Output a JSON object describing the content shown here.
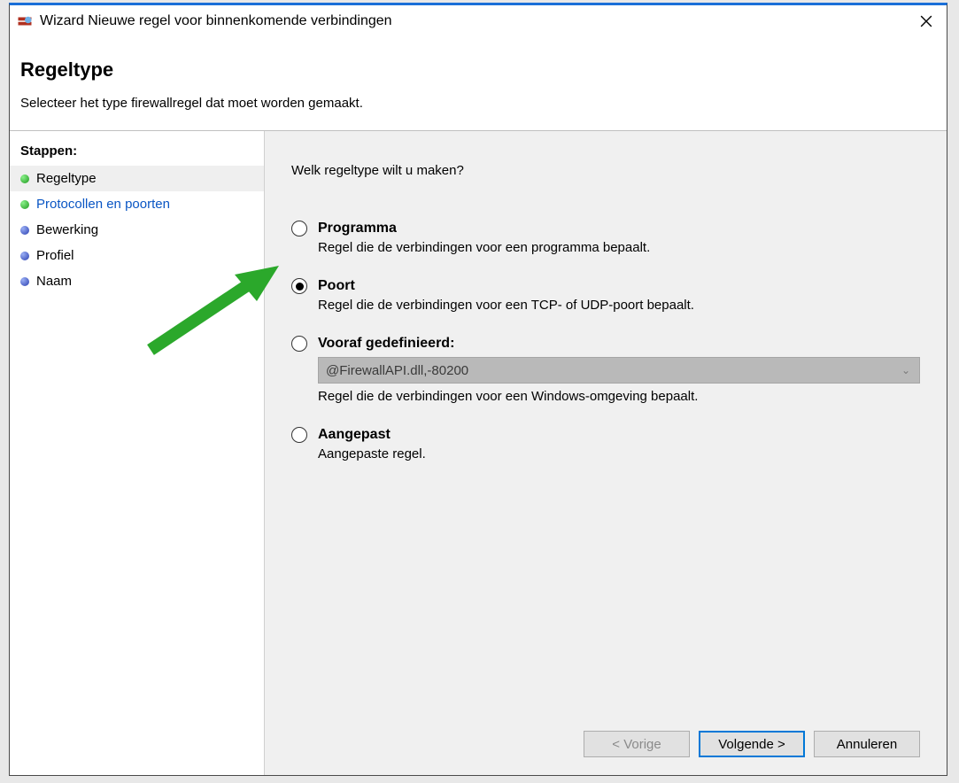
{
  "window": {
    "title": "Wizard Nieuwe regel voor binnenkomende verbindingen"
  },
  "header": {
    "page_title": "Regeltype",
    "page_subtitle": "Selecteer het type firewallregel dat moet worden gemaakt."
  },
  "sidebar": {
    "heading": "Stappen:",
    "steps": [
      {
        "label": "Regeltype",
        "bullet": "green",
        "state": "current"
      },
      {
        "label": "Protocollen en poorten",
        "bullet": "green",
        "state": "link"
      },
      {
        "label": "Bewerking",
        "bullet": "blue",
        "state": "normal"
      },
      {
        "label": "Profiel",
        "bullet": "blue",
        "state": "normal"
      },
      {
        "label": "Naam",
        "bullet": "blue",
        "state": "normal"
      }
    ]
  },
  "main": {
    "question": "Welk regeltype wilt u maken?",
    "options": [
      {
        "title": "Programma",
        "desc": "Regel die de verbindingen voor een programma bepaalt.",
        "checked": false
      },
      {
        "title": "Poort",
        "desc": "Regel die de verbindingen voor een TCP- of UDP-poort bepaalt.",
        "checked": true
      },
      {
        "title": "Vooraf gedefinieerd:",
        "desc": "Regel die de verbindingen voor een Windows-omgeving bepaalt.",
        "checked": false,
        "dropdown_value": "@FirewallAPI.dll,-80200"
      },
      {
        "title": "Aangepast",
        "desc": "Aangepaste regel.",
        "checked": false
      }
    ]
  },
  "buttons": {
    "back": "< Vorige",
    "next": "Volgende >",
    "cancel": "Annuleren"
  }
}
